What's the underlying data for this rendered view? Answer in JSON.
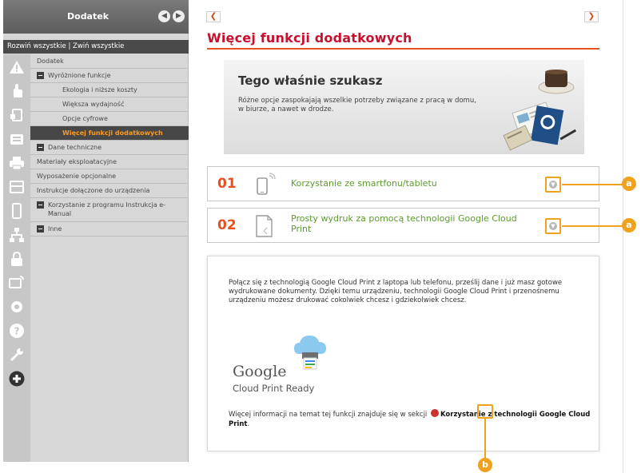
{
  "sidebar": {
    "title": "Dodatek",
    "expand_all": "Rozwiń wszystkie",
    "separator": "|",
    "collapse_all": "Zwiń wszystkie",
    "items": [
      {
        "label": "Dodatek"
      },
      {
        "label": "Wyróżnione funkcje"
      },
      {
        "label": "Ekologia i niższe koszty"
      },
      {
        "label": "Większa wydajność"
      },
      {
        "label": "Opcje cyfrowe"
      },
      {
        "label": "Więcej funkcji dodatkowych"
      },
      {
        "label": "Dane techniczne"
      },
      {
        "label": "Materiały eksploatacyjne"
      },
      {
        "label": "Wyposażenie opcjonalne"
      },
      {
        "label": "Instrukcje dołączone do urządzenia"
      },
      {
        "label": "Korzystanie z programu Instrukcja e-Manual"
      },
      {
        "label": "Inne"
      }
    ]
  },
  "main": {
    "title": "Więcej funkcji dodatkowych",
    "hero": {
      "title": "Tego właśnie szukasz",
      "text": "Różne opcje zaspokajają wszelkie potrzeby związane z pracą w domu, w biurze, a nawet w drodze."
    },
    "features": [
      {
        "number": "01",
        "label": "Korzystanie ze smartfonu/tabletu"
      },
      {
        "number": "02",
        "label": "Prosty wydruk za pomocą technologii Google Cloud Print"
      }
    ],
    "detail": {
      "text": "Połącz się z technologią Google Cloud Print z laptopa lub telefonu, prześlij dane i już masz gotowe wydrukowane dokumenty. Dzięki temu urządzeniu, technologii Google Cloud Print i przenośnemu urządzeniu możesz drukować cokolwiek chcesz i gdziekolwiek chcesz.",
      "logo_word": "Google",
      "logo_sub": "Cloud Print Ready",
      "more_prefix": "Więcej informacji na temat tej funkcji znajduje się w sekcji",
      "more_link": "Korzystanie z technologii Google Cloud Print",
      "more_suffix": "."
    }
  },
  "callouts": {
    "a": "a",
    "b": "b"
  },
  "colors": {
    "accent_red": "#c8102e",
    "accent_orange": "#e8501e",
    "feature_green": "#5c9b2e",
    "callout": "#f0a21e",
    "active_item_text": "#ff9a1e"
  }
}
